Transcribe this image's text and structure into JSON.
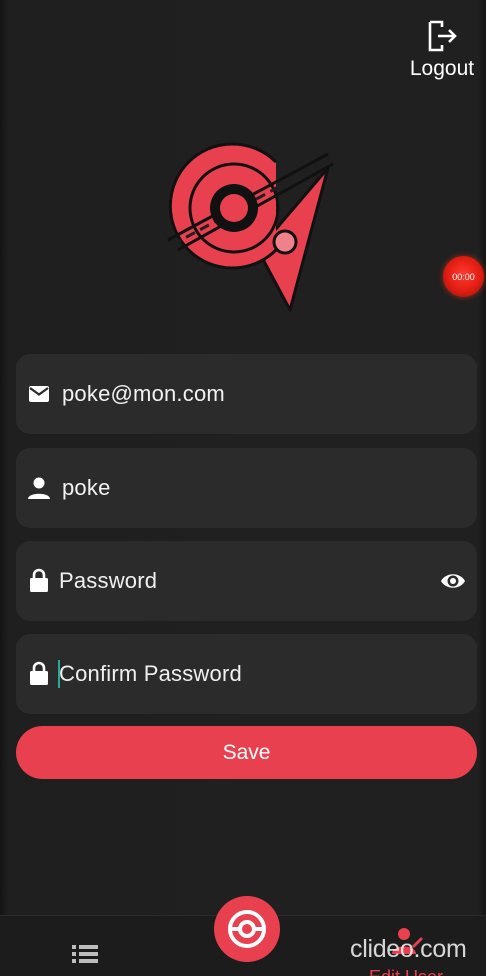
{
  "header": {
    "logout_label": "Logout"
  },
  "recorder": {
    "timer": "00:00"
  },
  "form": {
    "email_value": "poke@mon.com",
    "username_value": "poke",
    "password_placeholder": "Password",
    "confirm_password_placeholder": "Confirm Password",
    "save_label": "Save"
  },
  "bottom_nav": {
    "edit_user_label": "Edit User"
  },
  "watermark": "clideo.com",
  "colors": {
    "accent": "#e8404f",
    "field_bg": "#2b2b2b",
    "background": "#1f1f1f"
  }
}
